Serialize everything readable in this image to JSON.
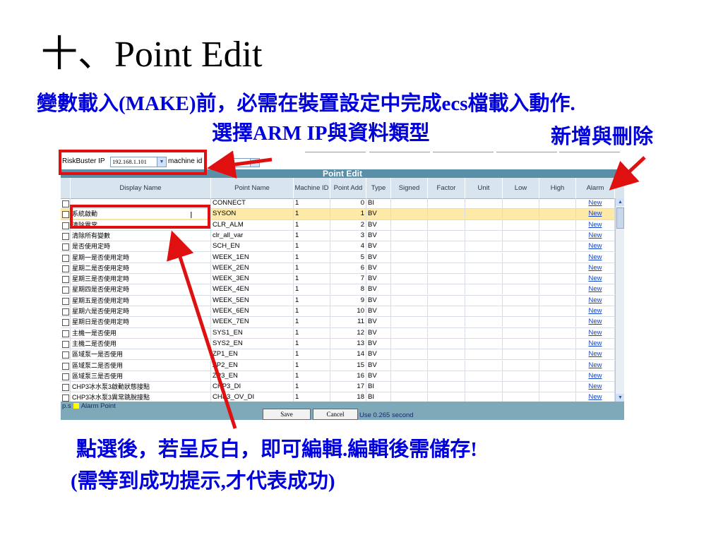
{
  "slide": {
    "title": "十、Point Edit",
    "subtitle": "變數載入(MAKE)前，必需在裝置設定中完成ecs檔載入動作.",
    "note_select": "選擇ARM IP與資料類型",
    "note_add": "新增與刪除",
    "bottom_line1": "點選後，若呈反白，即可編輯.編輯後需儲存!",
    "bottom_line2": "(需等到成功提示,才代表成功)"
  },
  "toolbar": {
    "ip_label": "RiskBuster IP",
    "ip_value": "192.168.1.101",
    "machine_label": "machine id"
  },
  "table": {
    "title": "Point Edit",
    "headers": {
      "display_name": "Display Name",
      "point_name": "Point Name",
      "machine_id": "Machine ID",
      "point_add": "Point Add",
      "type": "Type",
      "signed": "Signed",
      "factor": "Factor",
      "unit": "Unit",
      "low": "Low",
      "high": "High",
      "alarm": "Alarm"
    },
    "rows": [
      {
        "display": "",
        "point": "CONNECT",
        "machine": "1",
        "add": "0",
        "type": "BI",
        "alarm": "New"
      },
      {
        "display": "系統啟動",
        "point": "SYSON",
        "machine": "1",
        "add": "1",
        "type": "BV",
        "alarm": "New"
      },
      {
        "display": "清除異常",
        "point": "CLR_ALM",
        "machine": "1",
        "add": "2",
        "type": "BV",
        "alarm": "New"
      },
      {
        "display": "清除所有變數",
        "point": "clr_all_var",
        "machine": "1",
        "add": "3",
        "type": "BV",
        "alarm": "New"
      },
      {
        "display": "是否使用定時",
        "point": "SCH_EN",
        "machine": "1",
        "add": "4",
        "type": "BV",
        "alarm": "New"
      },
      {
        "display": "星期一是否使用定時",
        "point": "WEEK_1EN",
        "machine": "1",
        "add": "5",
        "type": "BV",
        "alarm": "New"
      },
      {
        "display": "星期二是否使用定時",
        "point": "WEEK_2EN",
        "machine": "1",
        "add": "6",
        "type": "BV",
        "alarm": "New"
      },
      {
        "display": "星期三是否使用定時",
        "point": "WEEK_3EN",
        "machine": "1",
        "add": "7",
        "type": "BV",
        "alarm": "New"
      },
      {
        "display": "星期四是否使用定時",
        "point": "WEEK_4EN",
        "machine": "1",
        "add": "8",
        "type": "BV",
        "alarm": "New"
      },
      {
        "display": "星期五是否使用定時",
        "point": "WEEK_5EN",
        "machine": "1",
        "add": "9",
        "type": "BV",
        "alarm": "New"
      },
      {
        "display": "星期六是否使用定時",
        "point": "WEEK_6EN",
        "machine": "1",
        "add": "10",
        "type": "BV",
        "alarm": "New"
      },
      {
        "display": "星期日是否使用定時",
        "point": "WEEK_7EN",
        "machine": "1",
        "add": "11",
        "type": "BV",
        "alarm": "New"
      },
      {
        "display": "主機一是否使用",
        "point": "SYS1_EN",
        "machine": "1",
        "add": "12",
        "type": "BV",
        "alarm": "New"
      },
      {
        "display": "主機二是否使用",
        "point": "SYS2_EN",
        "machine": "1",
        "add": "13",
        "type": "BV",
        "alarm": "New"
      },
      {
        "display": "區域泵一是否使用",
        "point": "ZP1_EN",
        "machine": "1",
        "add": "14",
        "type": "BV",
        "alarm": "New"
      },
      {
        "display": "區域泵二是否使用",
        "point": "ZP2_EN",
        "machine": "1",
        "add": "15",
        "type": "BV",
        "alarm": "New"
      },
      {
        "display": "區域泵三是否使用",
        "point": "ZP3_EN",
        "machine": "1",
        "add": "16",
        "type": "BV",
        "alarm": "New"
      },
      {
        "display": "CHP3冰水泵3啟動狀態接點",
        "point": "CHP3_DI",
        "machine": "1",
        "add": "17",
        "type": "BI",
        "alarm": "New"
      },
      {
        "display": "CHP3冰水泵3異常跳脫接點",
        "point": "CHP3_OV_DI",
        "machine": "1",
        "add": "18",
        "type": "BI",
        "alarm": "New"
      }
    ]
  },
  "footer": {
    "legend_prefix": "p.s",
    "legend_text": "Alarm Point",
    "save_label": "Save",
    "cancel_label": "Cancel",
    "time_text": "Use 0.265 second"
  },
  "colors": {
    "annotation_blue": "#0000dd",
    "annotation_red": "#e01010",
    "highlight_row": "#ffe9a6",
    "header_bar": "#5a8fa8",
    "footer_bar": "#7ea9b8"
  }
}
